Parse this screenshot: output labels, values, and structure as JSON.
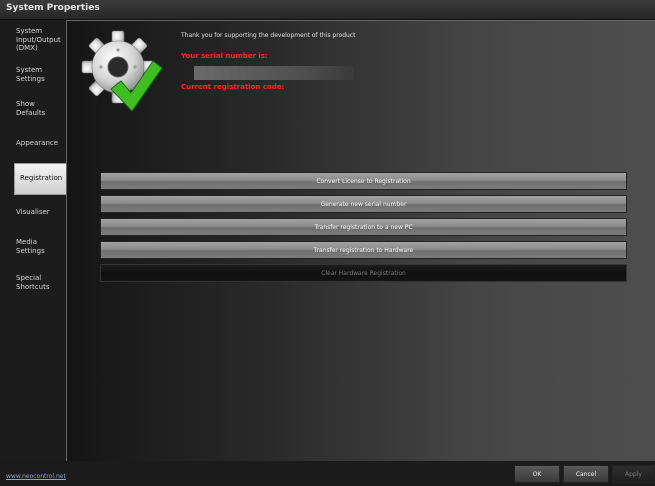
{
  "window": {
    "title": "System Properties"
  },
  "sidebar": {
    "items": [
      {
        "label": "System Input/Output (DMX)"
      },
      {
        "label": "System Settings"
      },
      {
        "label": "Show Defaults"
      },
      {
        "label": "Appearance"
      },
      {
        "label": "Registration",
        "active": true
      },
      {
        "label": "Visualiser"
      },
      {
        "label": "Media Settings"
      },
      {
        "label": "Special Shortcuts"
      }
    ]
  },
  "registration": {
    "thanks_text": "Thank you for supporting the development of this product",
    "serial_label": "Your serial number is:",
    "serial_value": "",
    "registration_label": "Current registration code:",
    "buttons": [
      {
        "label": "Convert License to Registration",
        "enabled": true
      },
      {
        "label": "Generate new serial number",
        "enabled": true
      },
      {
        "label": "Transfer registration to a new PC",
        "enabled": true
      },
      {
        "label": "Transfer registration to Hardware",
        "enabled": true
      },
      {
        "label": "Clear Hardware Registration",
        "enabled": false
      }
    ]
  },
  "footer": {
    "link": "www.neocontrol.net",
    "ok_label": "OK",
    "cancel_label": "Cancel",
    "apply_label": "Apply"
  },
  "colors": {
    "warning_text": "#ff2424",
    "check_green": "#3fbf1f",
    "accent_link": "#8fa6c8"
  }
}
